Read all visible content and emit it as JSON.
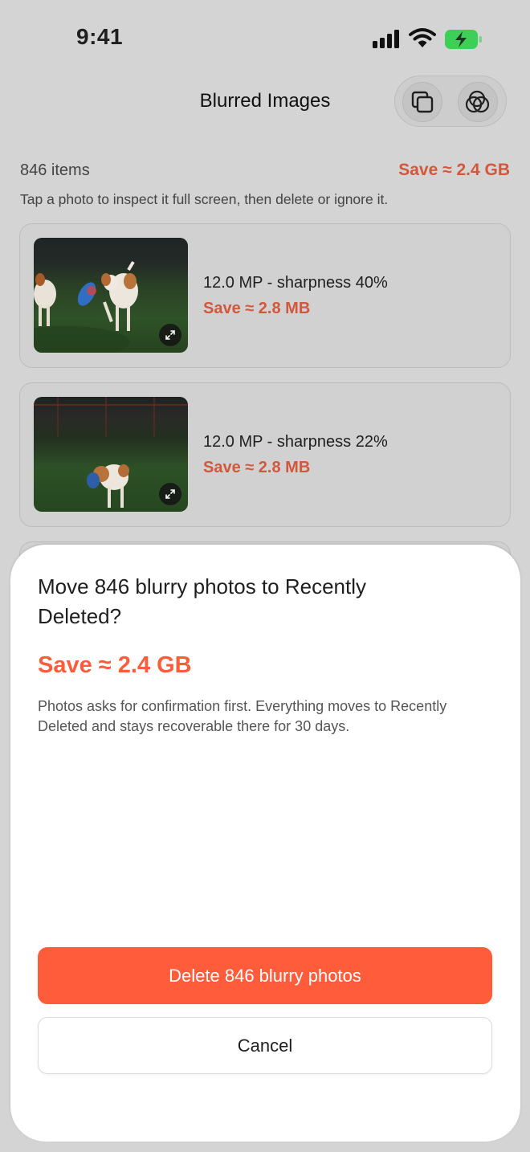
{
  "status_bar": {
    "time": "9:41"
  },
  "nav": {
    "title": "Blurred Images"
  },
  "summary": {
    "items_count": "846 items",
    "save": "Save ≈ 2.4 GB",
    "hint": "Tap a photo to inspect it full screen, then delete or ignore it."
  },
  "photos": [
    {
      "meta": "12.0 MP - sharpness 40%",
      "save": "Save ≈ 2.8 MB"
    },
    {
      "meta": "12.0 MP - sharpness 22%",
      "save": "Save ≈ 2.8 MB"
    }
  ],
  "sheet": {
    "title": "Move 846 blurry photos to Recently Deleted?",
    "save": "Save ≈ 2.4 GB",
    "description": "Photos asks for confirmation first. Everything moves to Recently Deleted and stays recoverable there for 30 days.",
    "delete_label": "Delete 846 blurry photos",
    "cancel_label": "Cancel"
  },
  "colors": {
    "accent": "#fe5c3b",
    "save_text_dimmed": "#d2573c",
    "background_dimmed": "#d4d4d4"
  },
  "icons": [
    "signal-icon",
    "wifi-icon",
    "battery-charging-icon",
    "duplicates-icon",
    "similar-photos-icon",
    "expand-icon"
  ]
}
